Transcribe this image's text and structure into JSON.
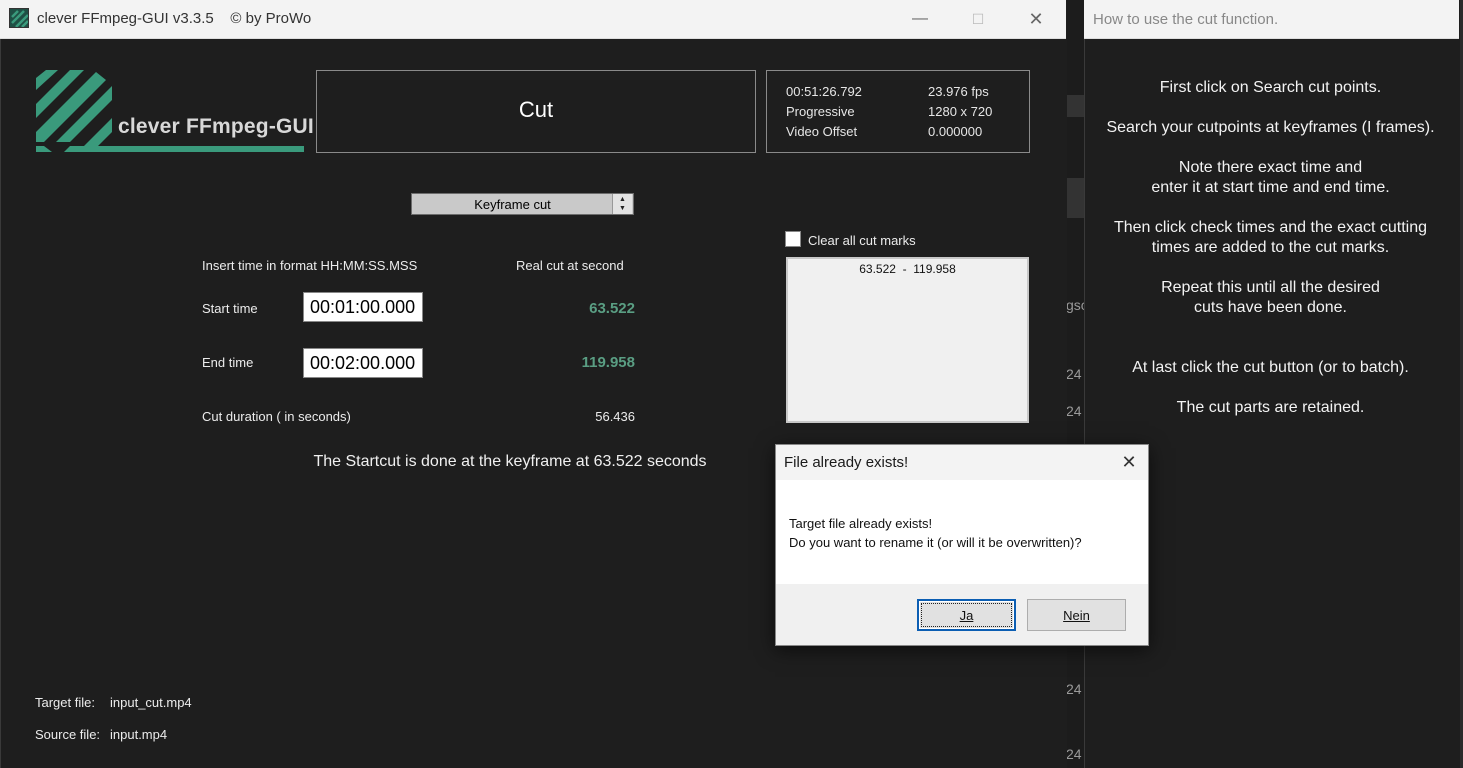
{
  "main_window": {
    "title": "clever FFmpeg-GUI v3.3.5    © by ProWo",
    "controls": {
      "minimize": "—",
      "maximize": "☐",
      "close": "✕"
    }
  },
  "logo": {
    "text": "clever FFmpeg-GUI",
    "color": "#3a9a7c"
  },
  "mode_title": "Cut",
  "video_info": {
    "duration": "00:51:26.792",
    "fps": "23.976 fps",
    "scan": "Progressive",
    "resolution": "1280 x 720",
    "offset_label": "Video Offset",
    "offset_value": "0.000000"
  },
  "cut_mode": {
    "selected": "Keyframe cut"
  },
  "form": {
    "format_hint": "Insert time in format HH:MM:SS.MSS",
    "real_cut_header": "Real cut at second",
    "start_label": "Start time",
    "start_value": "00:01:00.000",
    "start_real": "63.522",
    "end_label": "End time",
    "end_value": "00:02:00.000",
    "end_real": "119.958",
    "duration_label": "Cut duration ( in seconds)",
    "duration_value": "56.436",
    "startcut_message": "The Startcut is done at the keyframe at 63.522 seconds"
  },
  "cut_marks": {
    "clear_label": "Clear all cut marks",
    "items": [
      "63.522  -  119.958"
    ]
  },
  "files": {
    "target_label": "Target file:",
    "target_value": "input_cut.mp4",
    "source_label": "Source file:",
    "source_value": "input.mp4"
  },
  "help_window": {
    "title": "How to use the cut function.",
    "lines": {
      "l1": "First click on Search cut points.",
      "l2": "Search your cutpoints at keyframes (I frames).",
      "l3a": "Note there exact time and",
      "l3b": "enter it at start time and end time.",
      "l4a": "Then click check times and the exact cutting",
      "l4b": "times are added to the cut marks.",
      "l5a": "Repeat this until all the desired",
      "l5b": "cuts have been done.",
      "l6": "At last click the cut button (or to batch).",
      "l7": "The cut parts are retained."
    }
  },
  "dialog": {
    "title": "File already exists!",
    "message_line1": "Target file already exists!",
    "message_line2": "Do you want to rename it (or will it be overwritten)?",
    "yes_label": "Ja",
    "no_label": "Nein",
    "close": "✕"
  },
  "background_fragments": {
    "f1": "gsc",
    "f2": "24",
    "f3": "24",
    "f4": "24",
    "f5": "24"
  }
}
